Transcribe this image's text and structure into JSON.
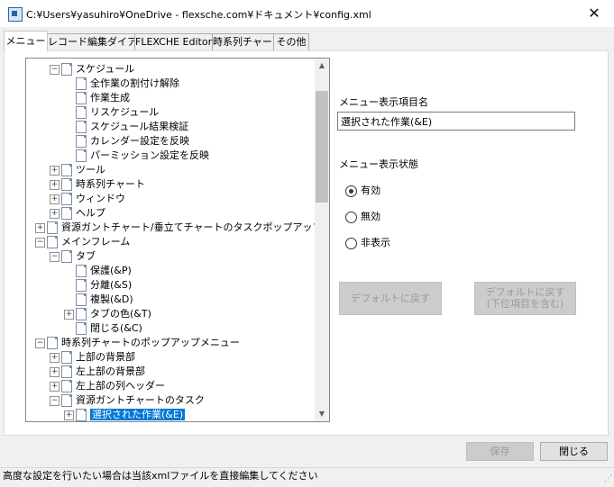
{
  "window": {
    "title": "C:¥Users¥yasuhiro¥OneDrive - flexsche.com¥ドキュメント¥config.xml",
    "close": "✕"
  },
  "tabs": [
    {
      "label": "メニュー",
      "active": true
    },
    {
      "label": "レコード編集ダイアログ",
      "active": false
    },
    {
      "label": "FLEXCHE Editor",
      "active": false
    },
    {
      "label": "時系列チャート",
      "active": false
    },
    {
      "label": "その他",
      "active": false
    }
  ],
  "tree": {
    "items": [
      {
        "label": "スケジュール",
        "level": 2,
        "expander": "−"
      },
      {
        "label": "全作業の割付け解除",
        "level": 3,
        "expander": ""
      },
      {
        "label": "作業生成",
        "level": 3,
        "expander": ""
      },
      {
        "label": "リスケジュール",
        "level": 3,
        "expander": ""
      },
      {
        "label": "スケジュール結果検証",
        "level": 3,
        "expander": ""
      },
      {
        "label": "カレンダー設定を反映",
        "level": 3,
        "expander": ""
      },
      {
        "label": "パーミッション設定を反映",
        "level": 3,
        "expander": ""
      },
      {
        "label": "ツール",
        "level": 2,
        "expander": "+"
      },
      {
        "label": "時系列チャート",
        "level": 2,
        "expander": "+"
      },
      {
        "label": "ウィンドウ",
        "level": 2,
        "expander": "+"
      },
      {
        "label": "ヘルプ",
        "level": 2,
        "expander": "+"
      },
      {
        "label": "資源ガントチャート/垂立てチャートのタスクポップアップメニュー",
        "level": 1,
        "expander": "+"
      },
      {
        "label": "メインフレーム",
        "level": 1,
        "expander": "−"
      },
      {
        "label": "タブ",
        "level": 2,
        "expander": "−"
      },
      {
        "label": "保護(&P)",
        "level": 3,
        "expander": ""
      },
      {
        "label": "分離(&S)",
        "level": 3,
        "expander": ""
      },
      {
        "label": "複製(&D)",
        "level": 3,
        "expander": ""
      },
      {
        "label": "タブの色(&T)",
        "level": 3,
        "expander": "+"
      },
      {
        "label": "閉じる(&C)",
        "level": 3,
        "expander": ""
      },
      {
        "label": "時系列チャートのポップアップメニュー",
        "level": 1,
        "expander": "−"
      },
      {
        "label": "上部の背景部",
        "level": 2,
        "expander": "+"
      },
      {
        "label": "左上部の背景部",
        "level": 2,
        "expander": "+"
      },
      {
        "label": "左上部の列ヘッダー",
        "level": 2,
        "expander": "+"
      },
      {
        "label": "資源ガントチャートのタスク",
        "level": 2,
        "expander": "−"
      },
      {
        "label": "選択された作業(&E)",
        "level": 3,
        "expander": "+",
        "selected": true
      }
    ],
    "scroll_up": "▲",
    "scroll_down": "▼"
  },
  "details": {
    "name_label": "メニュー表示項目名",
    "name_value": "選択された作業(&E)",
    "state_label": "メニュー表示状態",
    "options": [
      {
        "label": "有効",
        "checked": true
      },
      {
        "label": "無効",
        "checked": false
      },
      {
        "label": "非表示",
        "checked": false
      }
    ],
    "reset_button": "デフォルトに戻す",
    "reset_all_line1": "デフォルトに戻す",
    "reset_all_line2": "(下位項目を含む)"
  },
  "footer": {
    "save": "保存",
    "close": "閉じる"
  },
  "status": {
    "text": "高度な設定を行いたい場合は当該xmlファイルを直接編集してください"
  }
}
